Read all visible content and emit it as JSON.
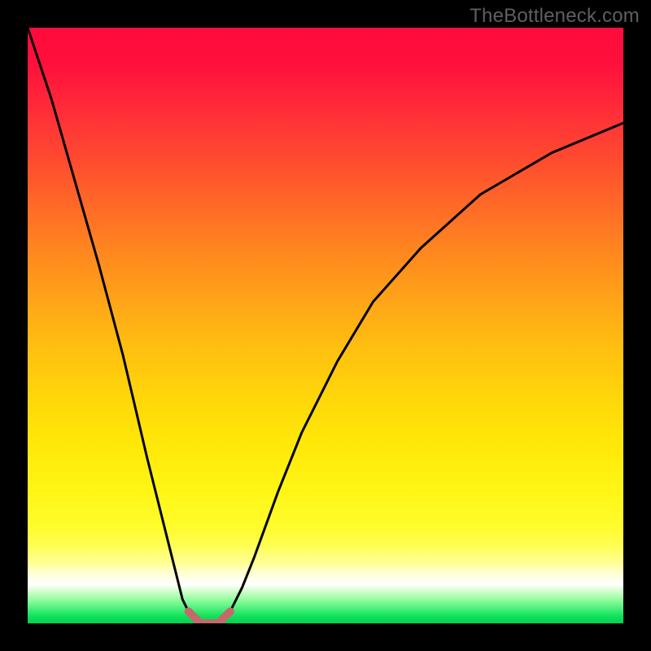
{
  "watermark": "TheBottleneck.com",
  "chart_data": {
    "type": "line",
    "title": "",
    "xlabel": "",
    "ylabel": "",
    "xlim": [
      0,
      100
    ],
    "ylim": [
      0,
      100
    ],
    "background_gradient_axis": "y",
    "background_gradient": [
      {
        "stop": 0,
        "color": "#00d24d"
      },
      {
        "stop": 6,
        "color": "#ffffff"
      },
      {
        "stop": 10,
        "color": "#fffd55"
      },
      {
        "stop": 20,
        "color": "#ffe808"
      },
      {
        "stop": 40,
        "color": "#ffa518"
      },
      {
        "stop": 70,
        "color": "#ff4a30"
      },
      {
        "stop": 100,
        "color": "#ff0b3d"
      }
    ],
    "series": [
      {
        "name": "bottleneck-curve",
        "color": "#000000",
        "stroke_width": 3,
        "x": [
          0,
          4,
          8,
          12,
          16,
          20,
          22,
          24,
          26,
          27,
          28,
          29,
          30,
          31,
          32,
          33,
          34,
          36,
          38,
          42,
          46,
          52,
          58,
          66,
          76,
          88,
          100
        ],
        "y": [
          100,
          88,
          74,
          60,
          45,
          28,
          20,
          12,
          4,
          2,
          1,
          0,
          0,
          0,
          0,
          1,
          2,
          6,
          11,
          22,
          32,
          44,
          54,
          63,
          72,
          79,
          84
        ]
      },
      {
        "name": "optimum-marker",
        "color": "#c46a6a",
        "stroke_width": 10,
        "linecap": "round",
        "x": [
          27,
          28,
          29,
          30,
          31,
          32,
          33,
          34
        ],
        "y": [
          2,
          1,
          0,
          0,
          0,
          0,
          1,
          2
        ]
      }
    ]
  }
}
